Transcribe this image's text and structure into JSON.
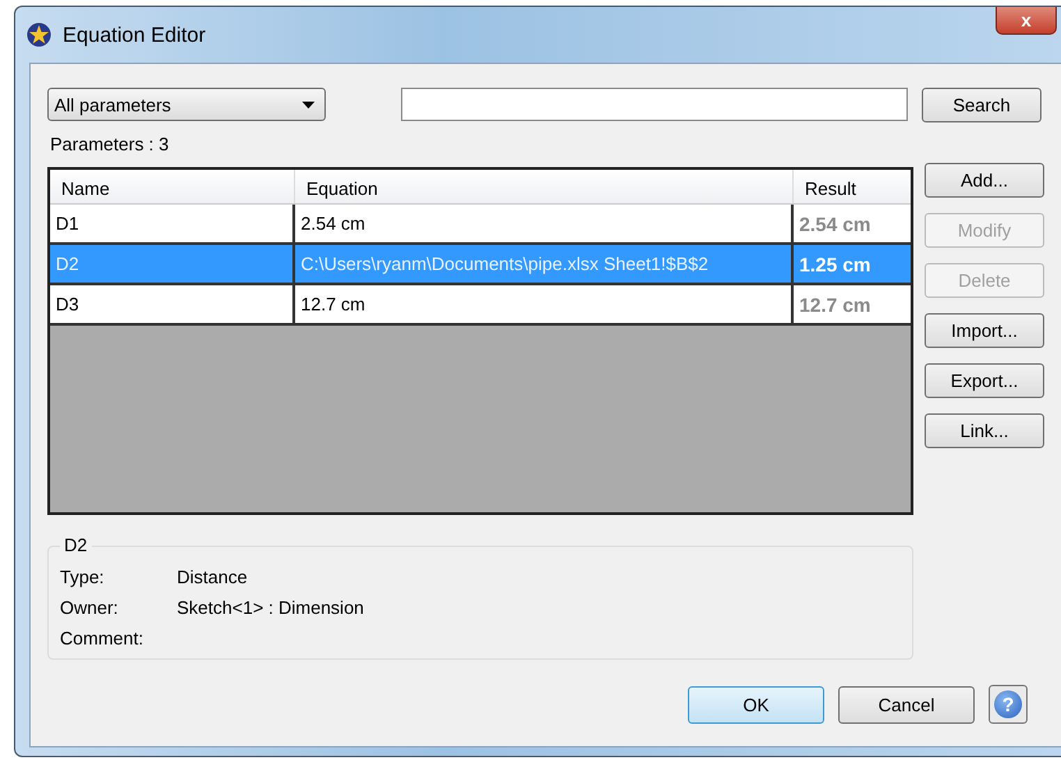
{
  "window": {
    "title": "Equation Editor",
    "close": "x"
  },
  "filter": {
    "value": "All parameters"
  },
  "search": {
    "button": "Search"
  },
  "count_label": "Parameters :  3",
  "table": {
    "columns": [
      "Name",
      "Equation",
      "Result"
    ],
    "rows": [
      {
        "name": "D1",
        "equation": "2.54 cm",
        "result": "2.54 cm",
        "selected": false
      },
      {
        "name": "D2",
        "equation": "C:\\Users\\ryanm\\Documents\\pipe.xlsx Sheet1!$B$2",
        "result": "1.25 cm",
        "selected": true
      },
      {
        "name": "D3",
        "equation": "12.7 cm",
        "result": "12.7 cm",
        "selected": false
      }
    ]
  },
  "side_buttons": [
    {
      "label": "Add...",
      "disabled": false
    },
    {
      "label": "Modify",
      "disabled": true
    },
    {
      "label": "Delete",
      "disabled": true
    },
    {
      "label": "Import...",
      "disabled": false
    },
    {
      "label": "Export...",
      "disabled": false
    },
    {
      "label": "Link...",
      "disabled": false
    }
  ],
  "details": {
    "title": "D2",
    "fields": [
      {
        "label": "Type:",
        "value": "Distance"
      },
      {
        "label": "Owner:",
        "value": "Sketch<1> : Dimension"
      },
      {
        "label": "Comment:"
      }
    ]
  },
  "buttons": [
    {
      "label": "OK",
      "kind": "default"
    },
    {
      "label": "Cancel",
      "kind": "normal"
    }
  ],
  "help": "?"
}
